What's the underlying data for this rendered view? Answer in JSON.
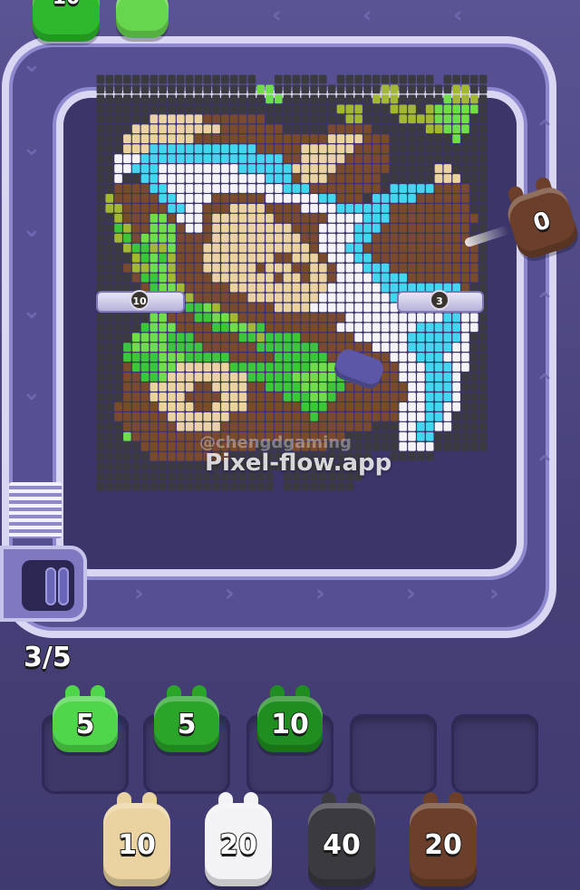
{
  "watermark": {
    "handle": "@chengdgaming",
    "site": "Pixel-flow.app"
  },
  "queue_counter": "3/5",
  "lanes": [
    {
      "name": "left-lane",
      "count": "10"
    },
    {
      "name": "right-lane",
      "count": "3"
    }
  ],
  "track_creature": {
    "color": "#6b3f2a",
    "count": "0"
  },
  "top_creatures": [
    {
      "color": "#2db82d",
      "count": "10"
    },
    {
      "color": "#67d64f",
      "count": ""
    }
  ],
  "slots": [
    {
      "filled": true,
      "color": "#4fd64a",
      "count": "5"
    },
    {
      "filled": true,
      "color": "#2aa52a",
      "count": "5"
    },
    {
      "filled": true,
      "color": "#1f8d20",
      "count": "10"
    },
    {
      "filled": false
    },
    {
      "filled": false
    }
  ],
  "upcoming": [
    {
      "color": "#ead3a0",
      "count": "10"
    },
    {
      "color": "#f3f3f6",
      "count": "20"
    },
    {
      "color": "#3a3a3f",
      "count": "40"
    },
    {
      "color": "#6b3f2a",
      "count": "20"
    }
  ],
  "palette": {
    "dark": "#3a3a40",
    "cream": "#ead3a0",
    "brown": "#7a4a2d",
    "lightbrown": "#a06a3e",
    "white": "#f4f4f8",
    "cyan": "#43d6ef",
    "green": "#3cc63a",
    "olive": "#a3b832",
    "limegreen": "#70dd4a"
  }
}
